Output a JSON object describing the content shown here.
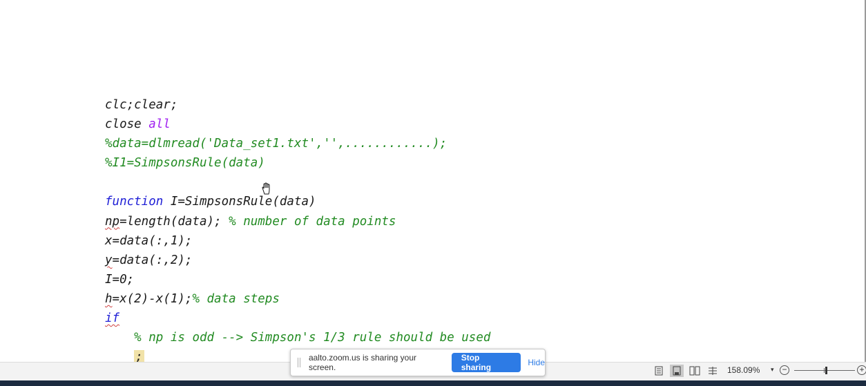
{
  "code_lines": [
    {
      "id": "l1",
      "segments": [
        {
          "t": "clc;clear;"
        }
      ]
    },
    {
      "id": "l2",
      "segments": [
        {
          "t": "close "
        },
        {
          "t": "all",
          "c": "kw-purple"
        }
      ]
    },
    {
      "id": "l3",
      "segments": [
        {
          "t": "%data=dlmread('Data_set1.txt','',............);",
          "c": "comment"
        }
      ]
    },
    {
      "id": "l4",
      "segments": [
        {
          "t": "%I1=SimpsonsRule(data)",
          "c": "comment"
        }
      ]
    },
    {
      "id": "l5",
      "segments": [
        {
          "t": ""
        }
      ]
    },
    {
      "id": "l6",
      "segments": [
        {
          "t": "function",
          "c": "kw-blue"
        },
        {
          "t": " I=SimpsonsRule(data)"
        }
      ]
    },
    {
      "id": "l7",
      "segments": [
        {
          "t": "np",
          "c": "squig"
        },
        {
          "t": "=length(data); "
        },
        {
          "t": "% number of data points",
          "c": "comment"
        }
      ]
    },
    {
      "id": "l8",
      "segments": [
        {
          "t": "x=data(:,1);"
        }
      ]
    },
    {
      "id": "l9",
      "segments": [
        {
          "t": "y",
          "c": "squig"
        },
        {
          "t": "=data(:,2);"
        }
      ]
    },
    {
      "id": "l10",
      "segments": [
        {
          "t": "I=0;"
        }
      ]
    },
    {
      "id": "l11",
      "segments": [
        {
          "t": "h",
          "c": "squig"
        },
        {
          "t": "=x(2)-x(1);"
        },
        {
          "t": "% data steps",
          "c": "comment"
        }
      ]
    },
    {
      "id": "l12",
      "segments": [
        {
          "t": "if",
          "c": "kw-blue squig"
        }
      ]
    },
    {
      "id": "l13",
      "segments": [
        {
          "t": "    "
        },
        {
          "t": "% np is odd --> Simpson's 1/3 rule should be used",
          "c": "comment"
        }
      ]
    },
    {
      "id": "l14",
      "segments": [
        {
          "t": "    "
        },
        {
          "t": ";",
          "c": "semi-hl"
        }
      ]
    }
  ],
  "share_banner": {
    "message": "aalto.zoom.us is sharing your screen.",
    "stop_label": "Stop sharing",
    "hide_label": "Hide"
  },
  "statusbar": {
    "zoom_level": "158.09%",
    "zoom_caret": "▾",
    "zoom_minus": "−",
    "zoom_plus": "+",
    "zoom_fraction": 0.52
  },
  "icons": {
    "cursor": "hand-cursor-icon",
    "views": [
      "read-mode-icon",
      "print-layout-icon",
      "web-layout-icon",
      "outline-icon"
    ]
  },
  "colors": {
    "comment": "#228b22",
    "keyword_blue": "#1f1fd6",
    "keyword_purple": "#a020f0",
    "stop_button": "#2d7be5"
  }
}
